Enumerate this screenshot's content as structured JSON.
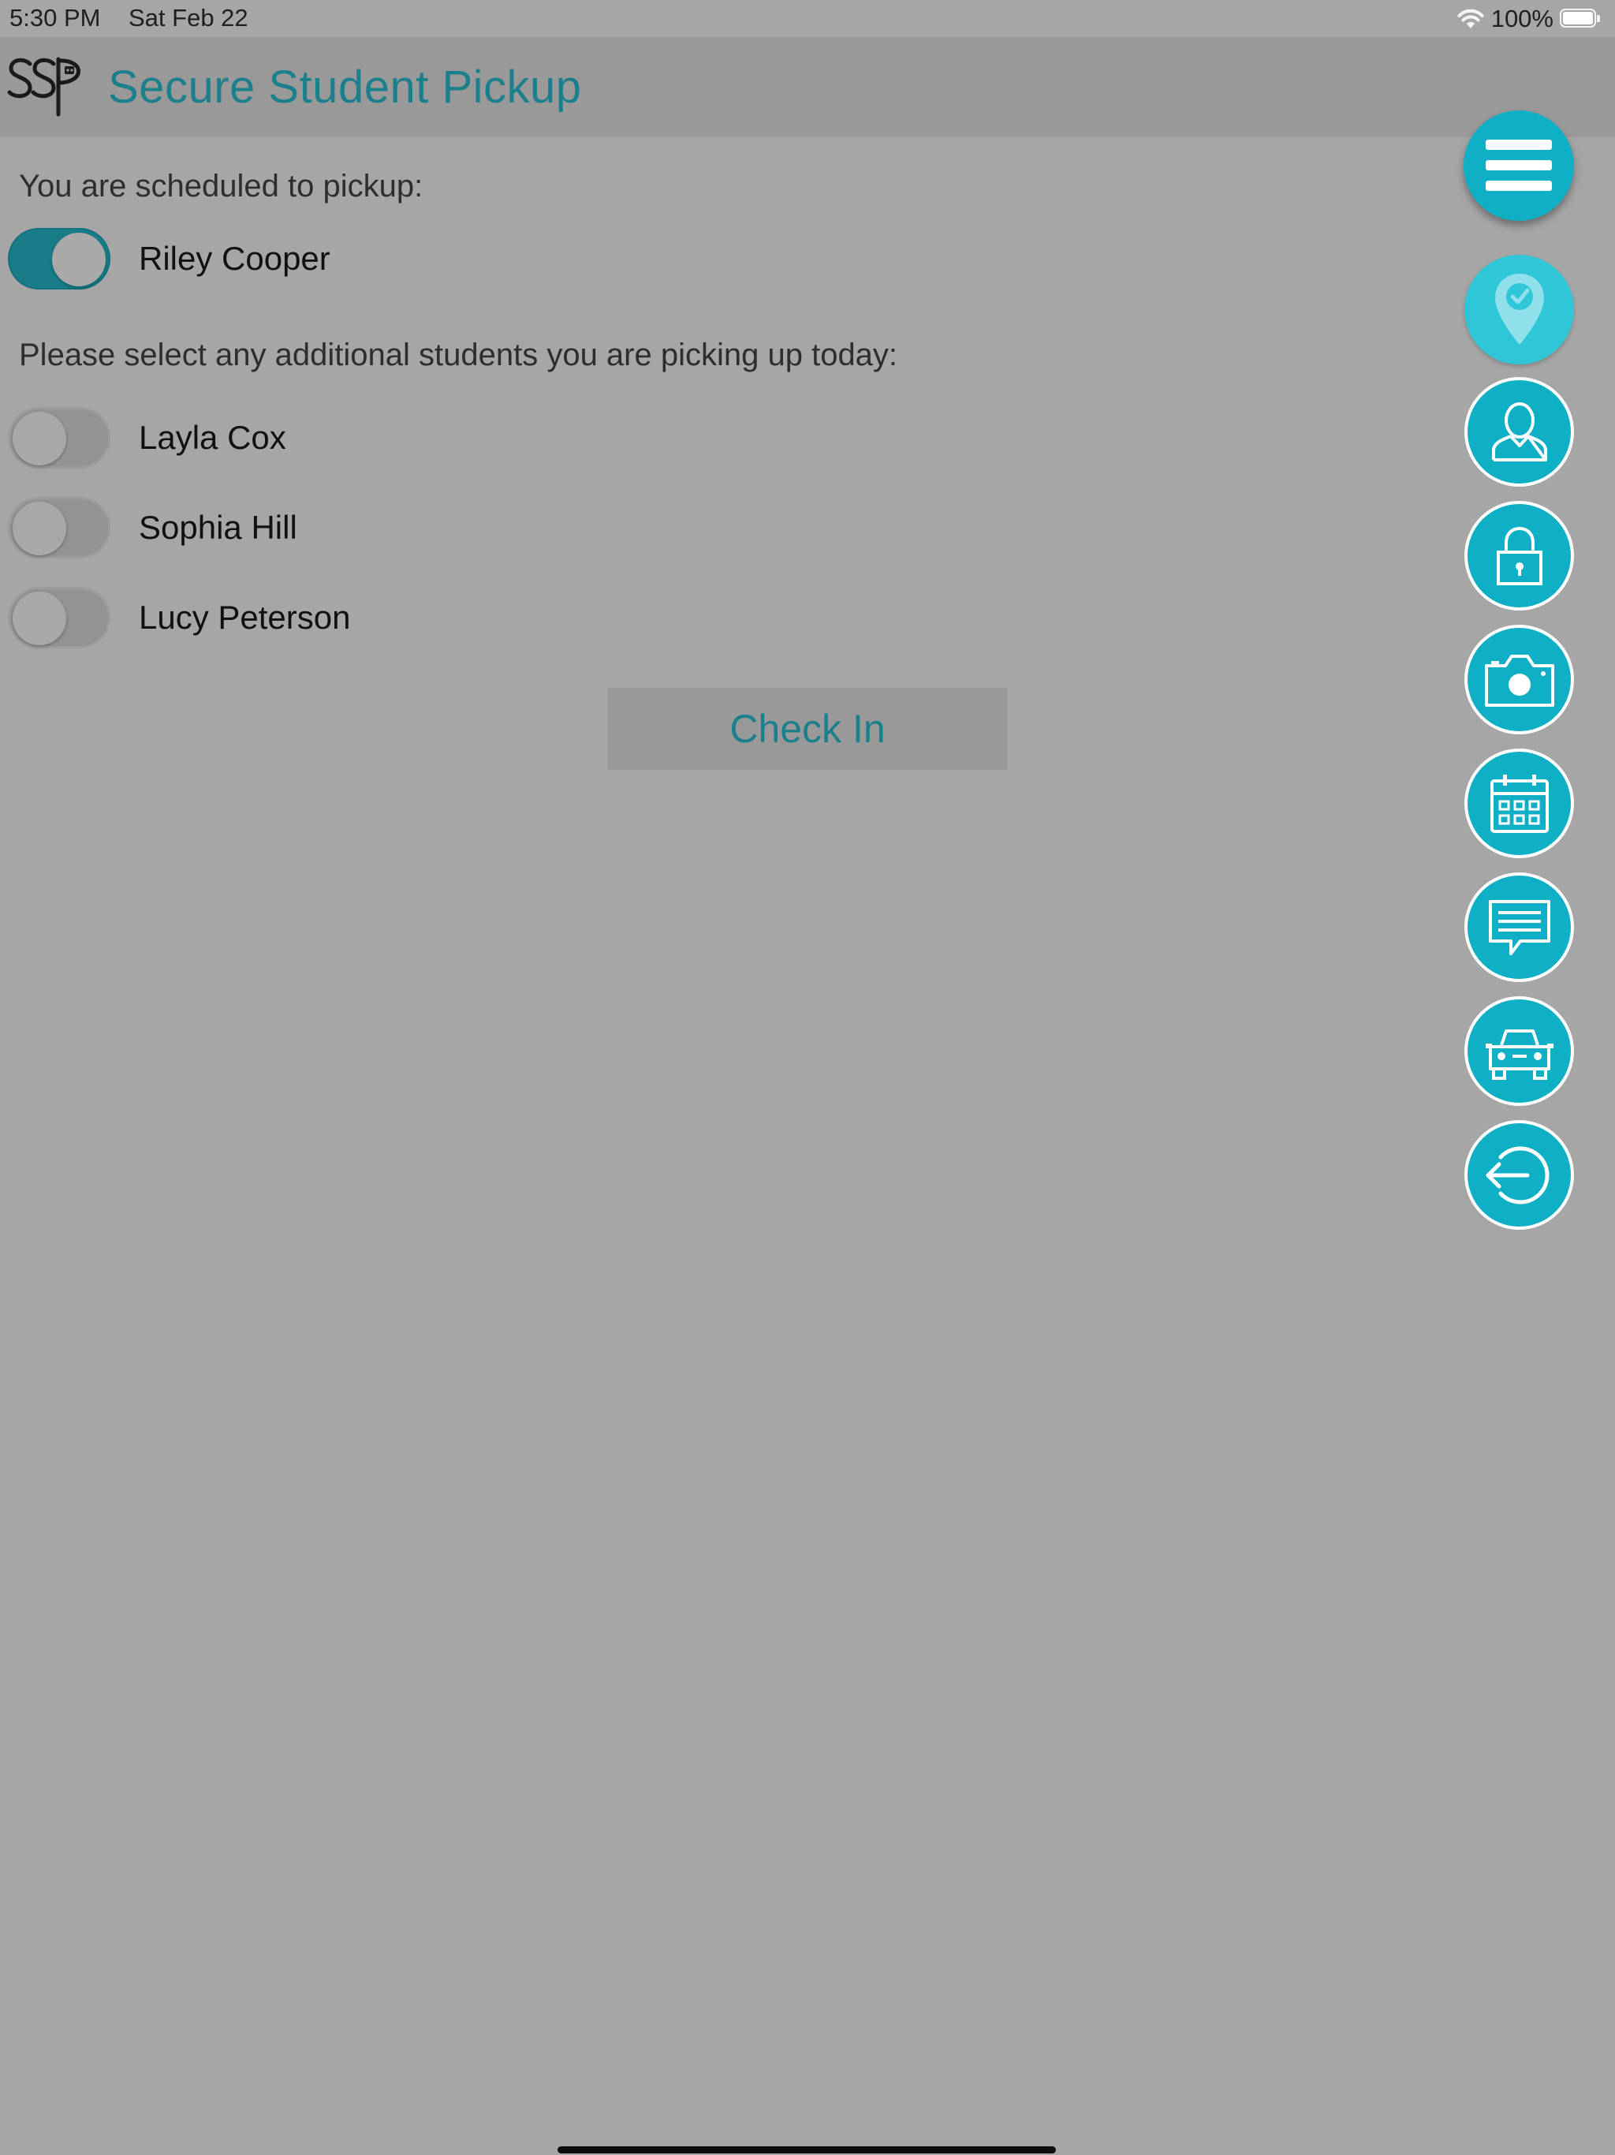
{
  "status_bar": {
    "time": "5:30 PM",
    "date": "Sat Feb 22",
    "battery": "100%"
  },
  "header": {
    "logo_text": "SSP",
    "title": "Secure Student Pickup"
  },
  "scheduled": {
    "label": "You are scheduled to pickup:",
    "students": [
      {
        "name": "Riley Cooper",
        "selected": true
      }
    ]
  },
  "additional": {
    "label": "Please select any additional students you are picking up today:",
    "students": [
      {
        "name": "Layla Cox",
        "selected": false
      },
      {
        "name": "Sophia Hill",
        "selected": false
      },
      {
        "name": "Lucy Peterson",
        "selected": false
      }
    ]
  },
  "check_in": {
    "label": "Check In"
  },
  "action_menu": {
    "menu_icon": "hamburger-icon",
    "items": [
      "location-check-icon",
      "profile-icon",
      "lock-icon",
      "camera-icon",
      "calendar-icon",
      "chat-icon",
      "car-icon",
      "logout-icon"
    ]
  },
  "colors": {
    "background": "#a6a6a6",
    "header": "#999999",
    "accent": "#1c7f8c",
    "fab": "#0fb0c6",
    "toggle_on": "#197d89"
  }
}
